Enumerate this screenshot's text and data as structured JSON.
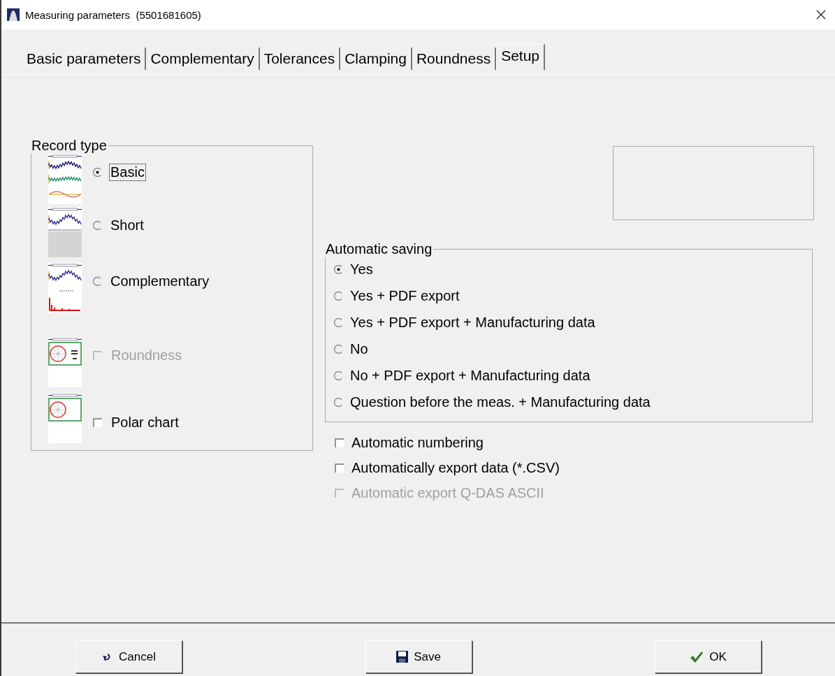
{
  "window": {
    "title": "Measuring parameters  (5501681605)"
  },
  "tabs": [
    {
      "label": "Basic parameters",
      "selected": false
    },
    {
      "label": "Complementary",
      "selected": false
    },
    {
      "label": "Tolerances",
      "selected": false
    },
    {
      "label": "Clamping",
      "selected": false
    },
    {
      "label": "Roundness",
      "selected": false
    },
    {
      "label": "Setup",
      "selected": true
    }
  ],
  "record_type": {
    "title": "Record type",
    "options": [
      {
        "kind": "radio",
        "thumbnail": {
          "kind": "basic"
        },
        "label": "Basic",
        "selected": true,
        "focused": true,
        "disabled": false
      },
      {
        "kind": "radio",
        "thumbnail": {
          "kind": "short"
        },
        "label": "Short",
        "selected": false,
        "focused": false,
        "disabled": false
      },
      {
        "kind": "radio",
        "thumbnail": {
          "kind": "complementary"
        },
        "label": "Complementary",
        "selected": false,
        "focused": false,
        "disabled": false
      },
      {
        "kind": "checkbox",
        "thumbnail": {
          "kind": "roundness"
        },
        "label": "Roundness",
        "checked": false,
        "focused": false,
        "disabled": true
      },
      {
        "kind": "checkbox",
        "thumbnail": {
          "kind": "polar"
        },
        "label": "Polar chart",
        "checked": false,
        "focused": false,
        "disabled": false
      }
    ]
  },
  "automatic_saving": {
    "title": "Automatic saving",
    "options": [
      {
        "label": "Yes",
        "selected": true
      },
      {
        "label": "Yes + PDF export",
        "selected": false
      },
      {
        "label": "Yes + PDF export + Manufacturing data",
        "selected": false
      },
      {
        "label": "No",
        "selected": false
      },
      {
        "label": "No + PDF export + Manufacturing data",
        "selected": false
      },
      {
        "label": "Question before the meas. + Manufacturing data",
        "selected": false
      }
    ]
  },
  "options": [
    {
      "label": "Automatic numbering",
      "checked": false,
      "disabled": false
    },
    {
      "label": "Automatically export data (*.CSV)",
      "checked": false,
      "disabled": false
    },
    {
      "label": "Automatic export Q-DAS ASCII",
      "checked": false,
      "disabled": true
    }
  ],
  "buttons": [
    {
      "kind": "cancel",
      "label": "Cancel"
    },
    {
      "kind": "save",
      "label": "Save"
    },
    {
      "kind": "ok",
      "label": "OK"
    }
  ]
}
